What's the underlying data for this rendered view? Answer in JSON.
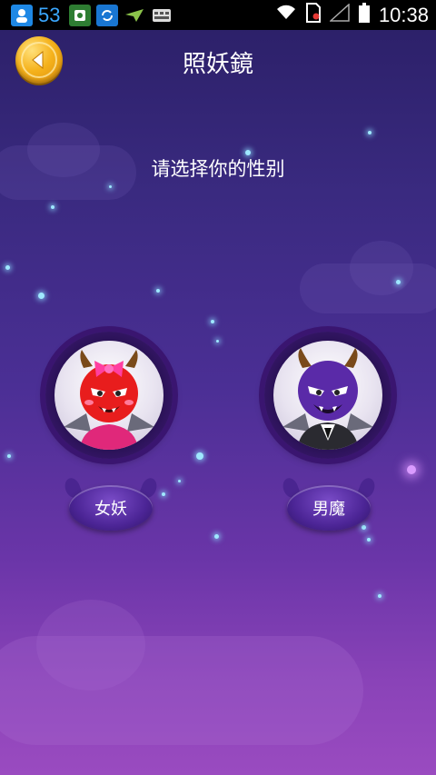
{
  "status_bar": {
    "notification_count": "53",
    "time": "10:38"
  },
  "header": {
    "title": "照妖鏡"
  },
  "main": {
    "prompt": "请选择你的性别",
    "options": [
      {
        "label": "女妖"
      },
      {
        "label": "男魔"
      }
    ]
  },
  "colors": {
    "accent": "#f5b21c",
    "button": "#4c2596",
    "background_top": "#2a1f66",
    "background_bottom": "#9a4bc0"
  }
}
